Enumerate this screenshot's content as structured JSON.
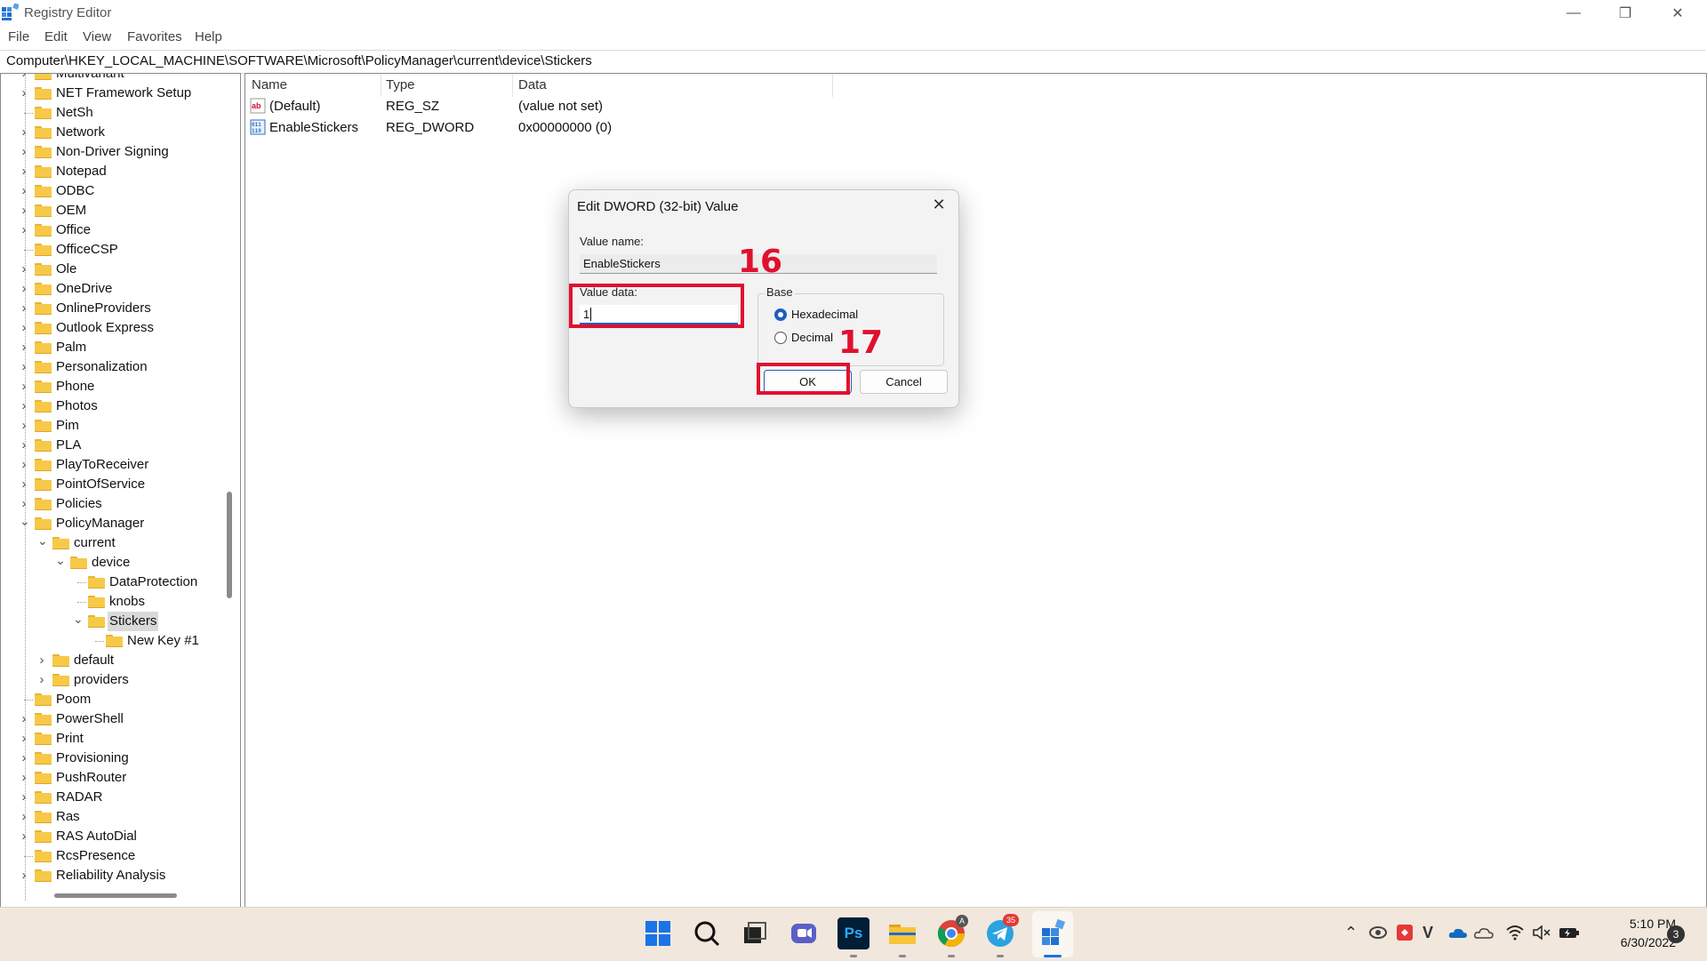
{
  "window": {
    "title": "Registry Editor",
    "minimize_glyph": "—",
    "restore_glyph": "❐",
    "close_glyph": "✕"
  },
  "menu": [
    "File",
    "Edit",
    "View",
    "Favorites",
    "Help"
  ],
  "address": "Computer\\HKEY_LOCAL_MACHINE\\SOFTWARE\\Microsoft\\PolicyManager\\current\\device\\Stickers",
  "tree": [
    {
      "label": "Multivariant",
      "expandable": true
    },
    {
      "label": "NET Framework Setup",
      "expandable": true
    },
    {
      "label": "NetSh",
      "expandable": false
    },
    {
      "label": "Network",
      "expandable": true
    },
    {
      "label": "Non-Driver Signing",
      "expandable": true
    },
    {
      "label": "Notepad",
      "expandable": true
    },
    {
      "label": "ODBC",
      "expandable": true
    },
    {
      "label": "OEM",
      "expandable": true
    },
    {
      "label": "Office",
      "expandable": true
    },
    {
      "label": "OfficeCSP",
      "expandable": false
    },
    {
      "label": "Ole",
      "expandable": true
    },
    {
      "label": "OneDrive",
      "expandable": true
    },
    {
      "label": "OnlineProviders",
      "expandable": true
    },
    {
      "label": "Outlook Express",
      "expandable": true
    },
    {
      "label": "Palm",
      "expandable": true
    },
    {
      "label": "Personalization",
      "expandable": true
    },
    {
      "label": "Phone",
      "expandable": true
    },
    {
      "label": "Photos",
      "expandable": true
    },
    {
      "label": "Pim",
      "expandable": true
    },
    {
      "label": "PLA",
      "expandable": true
    },
    {
      "label": "PlayToReceiver",
      "expandable": true
    },
    {
      "label": "PointOfService",
      "expandable": true
    },
    {
      "label": "Policies",
      "expandable": true
    },
    {
      "label": "PolicyManager",
      "expandable": true,
      "expanded": true
    },
    {
      "label": "current",
      "expandable": true,
      "expanded": true,
      "level": 1
    },
    {
      "label": "device",
      "expandable": true,
      "expanded": true,
      "level": 2
    },
    {
      "label": "DataProtection",
      "expandable": false,
      "level": 3
    },
    {
      "label": "knobs",
      "expandable": false,
      "level": 3
    },
    {
      "label": "Stickers",
      "expandable": true,
      "expanded": true,
      "level": 3,
      "selected": true
    },
    {
      "label": "New Key #1",
      "expandable": false,
      "level": 4
    },
    {
      "label": "default",
      "expandable": true,
      "level": 1
    },
    {
      "label": "providers",
      "expandable": true,
      "level": 1
    },
    {
      "label": "Poom",
      "expandable": false
    },
    {
      "label": "PowerShell",
      "expandable": true
    },
    {
      "label": "Print",
      "expandable": true
    },
    {
      "label": "Provisioning",
      "expandable": true
    },
    {
      "label": "PushRouter",
      "expandable": true
    },
    {
      "label": "RADAR",
      "expandable": true
    },
    {
      "label": "Ras",
      "expandable": true
    },
    {
      "label": "RAS AutoDial",
      "expandable": true
    },
    {
      "label": "RcsPresence",
      "expandable": false
    },
    {
      "label": "Reliability Analysis",
      "expandable": true
    }
  ],
  "list": {
    "columns": [
      "Name",
      "Type",
      "Data"
    ],
    "rows": [
      {
        "icon": "string-value-icon",
        "name": "(Default)",
        "type": "REG_SZ",
        "data": "(value not set)"
      },
      {
        "icon": "binary-value-icon",
        "name": "EnableStickers",
        "type": "REG_DWORD",
        "data": "0x00000000 (0)"
      }
    ]
  },
  "dialog": {
    "title": "Edit DWORD (32-bit) Value",
    "close_glyph": "✕",
    "value_name_label": "Value name:",
    "value_name": "EnableStickers",
    "value_data_label": "Value data:",
    "value_data": "1",
    "base_label": "Base",
    "base_options": [
      {
        "label": "Hexadecimal",
        "selected": true
      },
      {
        "label": "Decimal",
        "selected": false
      }
    ],
    "ok_label": "OK",
    "cancel_label": "Cancel"
  },
  "annotations": {
    "step_a": "16",
    "step_b": "17",
    "color": "#e0102f"
  },
  "taskbar": {
    "pinned": [
      "windows-start-icon",
      "search-icon",
      "task-view-icon",
      "chat-icon",
      "photoshop-icon",
      "file-explorer-icon",
      "chrome-icon",
      "telegram-icon",
      "registry-editor-icon"
    ],
    "telegram_badge": "35",
    "chrome_badge": "A",
    "photoshop_label": "Ps",
    "time": "5:10 PM",
    "date": "6/30/2022",
    "notification_count": "3"
  }
}
